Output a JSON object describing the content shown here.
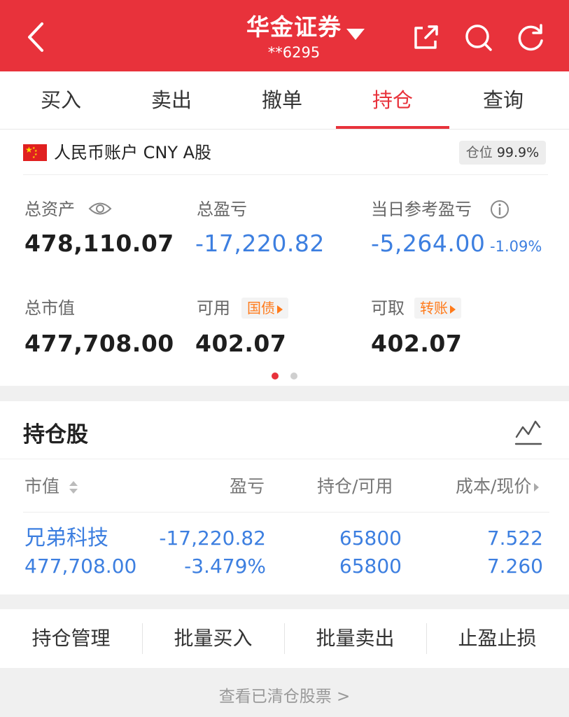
{
  "header": {
    "title": "华金证券",
    "account": "**6295"
  },
  "tabs": [
    "买入",
    "卖出",
    "撤单",
    "持仓",
    "查询"
  ],
  "active_tab": "持仓",
  "account_card": {
    "currency_label": "人民币账户 CNY A股",
    "position_label": "仓位",
    "position_value": "99.9%",
    "total_assets_label": "总资产",
    "total_assets": "478,110.07",
    "total_pnl_label": "总盈亏",
    "total_pnl": "-17,220.82",
    "daily_pnl_label": "当日参考盈亏",
    "daily_pnl": "-5,264.00",
    "daily_pnl_pct": "-1.09%",
    "market_value_label": "总市值",
    "market_value": "477,708.00",
    "available_label": "可用",
    "available_pill": "国债",
    "available": "402.07",
    "withdrawable_label": "可取",
    "withdrawable_pill": "转账",
    "withdrawable": "402.07"
  },
  "holdings": {
    "title": "持仓股",
    "columns": [
      "市值",
      "盈亏",
      "持仓/可用",
      "成本/现价"
    ],
    "rows": [
      {
        "name": "兄弟科技",
        "market_value": "477,708.00",
        "pnl": "-17,220.82",
        "pnl_pct": "-3.479%",
        "position": "65800",
        "available": "65800",
        "cost": "7.522",
        "price": "7.260"
      }
    ]
  },
  "actions": [
    "持仓管理",
    "批量买入",
    "批量卖出",
    "止盈止损"
  ],
  "cleared_link": "查看已清仓股票 >",
  "colors": {
    "brand_red": "#e8323b",
    "loss_blue": "#3d7fe0",
    "pill_orange": "#ff7a1a"
  }
}
